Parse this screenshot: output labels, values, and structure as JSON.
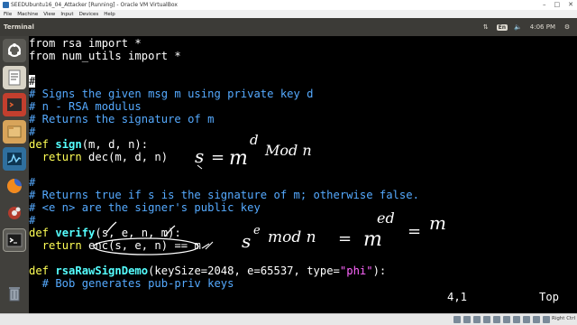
{
  "vbox": {
    "title": "SEEDUbuntu16_04_Attacker [Running] - Oracle VM VirtualBox",
    "menu": [
      "File",
      "Machine",
      "View",
      "Input",
      "Devices",
      "Help"
    ],
    "host_key": "Right Ctrl"
  },
  "panel": {
    "title": "Terminal",
    "keyboard_layout": "En",
    "time": "4:06 PM"
  },
  "launcher": {
    "items": [
      "dash-icon",
      "text-editor-icon",
      "terminal-red-icon",
      "files-icon",
      "system-monitor-icon",
      "firefox-icon",
      "settings-icon",
      "terminal-icon",
      "trash-icon"
    ]
  },
  "code": {
    "l1": "from rsa import *",
    "l2": "from num_utils import *",
    "l4_cursor": "#",
    "l5": "# Signs the given msg m using private key d",
    "l6": "# n - RSA modulus",
    "l7": "# Returns the signature of m",
    "l8": "#",
    "l9_kw": "def",
    "l9_fn": "sign",
    "l9_rest": "(m, d, n):",
    "l10_kw": "return",
    "l10_rest": " dec(m, d, n)",
    "l12": "#",
    "l13": "# Returns true if s is the signature of m; otherwise false.",
    "l14": "# <e n> are the signer's public key",
    "l15": "#",
    "l16_kw": "def",
    "l16_fn": "verify",
    "l16_rest": "(s, e, n, m):",
    "l17_kw": "return",
    "l17_rest": " enc(s, e, n) == m",
    "l19_kw": "def",
    "l19_fn": "rsaRawSignDemo",
    "l19_a": "(keySize=2048, e=65537, type=",
    "l19_str": "\"phi\"",
    "l19_b": "):",
    "l20": "  # Bob generates pub-priv keys"
  },
  "status": {
    "position": "4,1",
    "scroll": "Top"
  },
  "annotations": {
    "a1_s": "s",
    "a1_eq": "=",
    "a1_m": "m",
    "a1_d": "d",
    "a1_mod": "Mod n",
    "a2_s": "s",
    "a2_e": "e",
    "a2_mod": "mod n",
    "a2_eq1": "=",
    "a2_m": "m",
    "a2_ed": "ed",
    "a2_eq2": "=",
    "a2_m2": "m"
  },
  "colors": {
    "terminal_bg": "#000000",
    "keyword": "#ffff55",
    "comment": "#55aaff",
    "function": "#55ffff",
    "panel_bg": "#3c3b37",
    "launcher_bg": "#41403c"
  }
}
